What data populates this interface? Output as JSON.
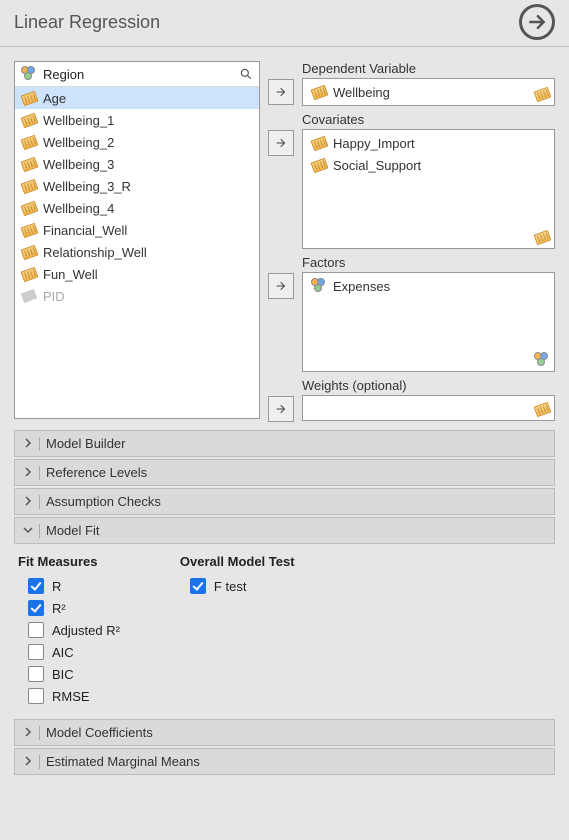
{
  "title": "Linear Regression",
  "search_var": "Region",
  "variables": [
    {
      "name": "Age",
      "icon": "ruler",
      "selected": true
    },
    {
      "name": "Wellbeing_1",
      "icon": "ruler"
    },
    {
      "name": "Wellbeing_2",
      "icon": "ruler"
    },
    {
      "name": "Wellbeing_3",
      "icon": "ruler"
    },
    {
      "name": "Wellbeing_3_R",
      "icon": "ruler"
    },
    {
      "name": "Wellbeing_4",
      "icon": "ruler"
    },
    {
      "name": "Financial_Well",
      "icon": "ruler"
    },
    {
      "name": "Relationship_Well",
      "icon": "ruler"
    },
    {
      "name": "Fun_Well",
      "icon": "ruler"
    },
    {
      "name": "PID",
      "icon": "tag",
      "muted": true
    }
  ],
  "slots": {
    "dependent": {
      "label": "Dependent Variable",
      "items": [
        {
          "name": "Wellbeing",
          "icon": "ruler"
        }
      ],
      "hint": "ruler"
    },
    "covariates": {
      "label": "Covariates",
      "items": [
        {
          "name": "Happy_Import",
          "icon": "ruler"
        },
        {
          "name": "Social_Support",
          "icon": "ruler"
        }
      ],
      "hint": "ruler"
    },
    "factors": {
      "label": "Factors",
      "items": [
        {
          "name": "Expenses",
          "icon": "circles"
        }
      ],
      "hint": "circles"
    },
    "weights": {
      "label": "Weights (optional)",
      "items": [],
      "hint": "ruler"
    }
  },
  "accordions": [
    {
      "label": "Model Builder",
      "open": false
    },
    {
      "label": "Reference Levels",
      "open": false
    },
    {
      "label": "Assumption Checks",
      "open": false
    },
    {
      "label": "Model Fit",
      "open": true
    },
    {
      "label": "Model Coefficients",
      "open": false
    },
    {
      "label": "Estimated Marginal Means",
      "open": false
    }
  ],
  "model_fit": {
    "fit_measures_title": "Fit Measures",
    "overall_title": "Overall Model Test",
    "fit_measures": [
      {
        "label": "R",
        "checked": true
      },
      {
        "label": "R²",
        "checked": true
      },
      {
        "label": "Adjusted R²",
        "checked": false
      },
      {
        "label": "AIC",
        "checked": false
      },
      {
        "label": "BIC",
        "checked": false
      },
      {
        "label": "RMSE",
        "checked": false
      }
    ],
    "overall": [
      {
        "label": "F test",
        "checked": true
      }
    ]
  }
}
